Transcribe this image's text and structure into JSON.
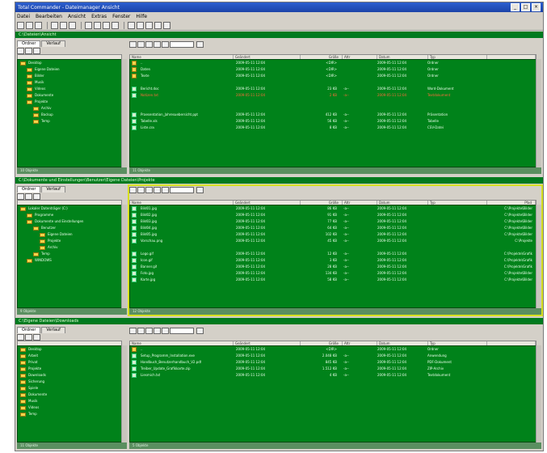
{
  "window": {
    "title": "Total Commander - Dateimanager Ansicht"
  },
  "menu": [
    "Datei",
    "Bearbeiten",
    "Ansicht",
    "Extras",
    "Fenster",
    "Hilfe"
  ],
  "toolbar_icons": [
    "new-icon",
    "open-icon",
    "save-icon",
    "back-icon",
    "forward-icon",
    "up-icon",
    "copy-icon",
    "move-icon",
    "delete-icon",
    "refresh-icon",
    "view-icon",
    "sort-icon",
    "filter-icon",
    "settings-icon",
    "help-icon"
  ],
  "panes": [
    {
      "header": "C:\\Dateien\\Ansicht",
      "left": {
        "tabs": [
          "Ordner",
          "Verlauf"
        ],
        "tree": [
          {
            "label": "Desktop",
            "indent": 0
          },
          {
            "label": "Eigene Dateien",
            "indent": 1
          },
          {
            "label": "Bilder",
            "indent": 1
          },
          {
            "label": "Musik",
            "indent": 1
          },
          {
            "label": "Videos",
            "indent": 1
          },
          {
            "label": "Dokumente",
            "indent": 1
          },
          {
            "label": "Projekte",
            "indent": 1
          },
          {
            "label": "Archiv",
            "indent": 2
          },
          {
            "label": "Backup",
            "indent": 2
          },
          {
            "label": "Temp",
            "indent": 2
          }
        ],
        "status": "10 Objekte"
      },
      "right": {
        "columns": [
          "Name",
          "Geändert",
          "Größe",
          "Attr",
          "Datum",
          "Typ",
          ""
        ],
        "rows": [
          {
            "type": "folder",
            "name": "..",
            "modified": "2009-05-11 12:04",
            "size": "<DIR>",
            "attr": "",
            "date": "2009-05-11 12:04",
            "kind": "Ordner",
            "extra": ""
          },
          {
            "type": "folder",
            "name": "Daten",
            "modified": "2009-05-11 12:04",
            "size": "<DIR>",
            "attr": "",
            "date": "2009-05-11 12:04",
            "kind": "Ordner",
            "extra": ""
          },
          {
            "type": "folder",
            "name": "Texte",
            "modified": "2009-05-11 12:04",
            "size": "<DIR>",
            "attr": "",
            "date": "2009-05-11 12:04",
            "kind": "Ordner",
            "extra": ""
          },
          {
            "type": "file",
            "name": "",
            "modified": "",
            "size": "",
            "attr": "",
            "date": "",
            "kind": "",
            "extra": ""
          },
          {
            "type": "file",
            "name": "Bericht.doc",
            "modified": "2009-05-11 12:04",
            "size": "23 KB",
            "attr": "-a--",
            "date": "2009-05-11 12:04",
            "kind": "Word-Dokument",
            "extra": ""
          },
          {
            "type": "file",
            "name": "Notizen.txt",
            "modified": "2009-05-11 12:04",
            "size": "2 KB",
            "attr": "-a--",
            "date": "2009-05-11 12:04",
            "kind": "Textdokument",
            "extra": "",
            "selected": true
          },
          {
            "type": "file",
            "name": "",
            "modified": "",
            "size": "",
            "attr": "",
            "date": "",
            "kind": "",
            "extra": ""
          },
          {
            "type": "file",
            "name": "",
            "modified": "",
            "size": "",
            "attr": "",
            "date": "",
            "kind": "",
            "extra": ""
          },
          {
            "type": "file",
            "name": "Praesentation_Jahresuebersicht.ppt",
            "modified": "2009-05-11 12:04",
            "size": "412 KB",
            "attr": "-a--",
            "date": "2009-05-11 12:04",
            "kind": "Präsentation",
            "extra": ""
          },
          {
            "type": "file",
            "name": "Tabelle.xls",
            "modified": "2009-05-11 12:04",
            "size": "56 KB",
            "attr": "-a--",
            "date": "2009-05-11 12:04",
            "kind": "Tabelle",
            "extra": ""
          },
          {
            "type": "file",
            "name": "Liste.csv",
            "modified": "2009-05-11 12:04",
            "size": "8 KB",
            "attr": "-a--",
            "date": "2009-05-11 12:04",
            "kind": "CSV-Datei",
            "extra": ""
          }
        ],
        "status": "11 Objekte"
      }
    },
    {
      "header": "C:\\Dokumente und Einstellungen\\Benutzer\\Eigene Dateien\\Projekte",
      "left": {
        "tabs": [
          "Ordner",
          "Verlauf"
        ],
        "tree": [
          {
            "label": "Lokaler Datenträger (C:)",
            "indent": 0
          },
          {
            "label": "Programme",
            "indent": 1
          },
          {
            "label": "Dokumente und Einstellungen",
            "indent": 1
          },
          {
            "label": "Benutzer",
            "indent": 2
          },
          {
            "label": "Eigene Dateien",
            "indent": 3
          },
          {
            "label": "Projekte",
            "indent": 3
          },
          {
            "label": "Archiv",
            "indent": 3
          },
          {
            "label": "Temp",
            "indent": 2
          },
          {
            "label": "WINDOWS",
            "indent": 1
          }
        ],
        "status": "9 Objekte"
      },
      "right": {
        "columns": [
          "Name",
          "Geändert",
          "Größe",
          "Attr",
          "Datum",
          "Typ",
          "Pfad"
        ],
        "rows": [
          {
            "type": "file",
            "name": "Bild01.jpg",
            "modified": "2009-05-11 12:04",
            "size": "86 KB",
            "attr": "-a--",
            "date": "2009-05-11 12:04",
            "kind": "",
            "extra": "C:\\Projekte\\Bilder"
          },
          {
            "type": "file",
            "name": "Bild02.jpg",
            "modified": "2009-05-11 12:04",
            "size": "91 KB",
            "attr": "-a--",
            "date": "2009-05-11 12:04",
            "kind": "",
            "extra": "C:\\Projekte\\Bilder"
          },
          {
            "type": "file",
            "name": "Bild03.jpg",
            "modified": "2009-05-11 12:04",
            "size": "77 KB",
            "attr": "-a--",
            "date": "2009-05-11 12:04",
            "kind": "",
            "extra": "C:\\Projekte\\Bilder"
          },
          {
            "type": "file",
            "name": "Bild04.jpg",
            "modified": "2009-05-11 12:04",
            "size": "64 KB",
            "attr": "-a--",
            "date": "2009-05-11 12:04",
            "kind": "",
            "extra": "C:\\Projekte\\Bilder"
          },
          {
            "type": "file",
            "name": "Bild05.jpg",
            "modified": "2009-05-11 12:04",
            "size": "102 KB",
            "attr": "-a--",
            "date": "2009-05-11 12:04",
            "kind": "",
            "extra": "C:\\Projekte\\Bilder"
          },
          {
            "type": "file",
            "name": "Vorschau.png",
            "modified": "2009-05-11 12:04",
            "size": "45 KB",
            "attr": "-a--",
            "date": "2009-05-11 12:04",
            "kind": "",
            "extra": "C:\\Projekte"
          },
          {
            "type": "file",
            "name": "",
            "modified": "",
            "size": "",
            "attr": "",
            "date": "",
            "kind": "",
            "extra": ""
          },
          {
            "type": "file",
            "name": "Logo.gif",
            "modified": "2009-05-11 12:04",
            "size": "12 KB",
            "attr": "-a--",
            "date": "2009-05-11 12:04",
            "kind": "",
            "extra": "C:\\Projekte\\Grafik"
          },
          {
            "type": "file",
            "name": "Icon.gif",
            "modified": "2009-05-11 12:04",
            "size": "3 KB",
            "attr": "-a--",
            "date": "2009-05-11 12:04",
            "kind": "",
            "extra": "C:\\Projekte\\Grafik"
          },
          {
            "type": "file",
            "name": "Banner.gif",
            "modified": "2009-05-11 12:04",
            "size": "28 KB",
            "attr": "-a--",
            "date": "2009-05-11 12:04",
            "kind": "",
            "extra": "C:\\Projekte\\Grafik"
          },
          {
            "type": "file",
            "name": "Foto.jpg",
            "modified": "2009-05-11 12:04",
            "size": "134 KB",
            "attr": "-a--",
            "date": "2009-05-11 12:04",
            "kind": "",
            "extra": "C:\\Projekte\\Bilder"
          },
          {
            "type": "file",
            "name": "Karte.jpg",
            "modified": "2009-05-11 12:04",
            "size": "58 KB",
            "attr": "-a--",
            "date": "2009-05-11 12:04",
            "kind": "",
            "extra": "C:\\Projekte\\Bilder"
          }
        ],
        "status": "12 Objekte"
      }
    },
    {
      "header": "C:\\Eigene Dateien\\Downloads",
      "left": {
        "tabs": [
          "Ordner",
          "Verlauf"
        ],
        "tree": [
          {
            "label": "Desktop",
            "indent": 0
          },
          {
            "label": "Arbeit",
            "indent": 0
          },
          {
            "label": "Privat",
            "indent": 0
          },
          {
            "label": "Projekte",
            "indent": 0
          },
          {
            "label": "Downloads",
            "indent": 0
          },
          {
            "label": "Sicherung",
            "indent": 0
          },
          {
            "label": "Spiele",
            "indent": 0
          },
          {
            "label": "Dokumente",
            "indent": 0
          },
          {
            "label": "Musik",
            "indent": 0
          },
          {
            "label": "Videos",
            "indent": 0
          },
          {
            "label": "Temp",
            "indent": 0
          }
        ],
        "status": "11 Objekte"
      },
      "right": {
        "columns": [
          "Name",
          "Geändert",
          "Größe",
          "Attr",
          "Datum",
          "Typ",
          ""
        ],
        "rows": [
          {
            "type": "folder",
            "name": "..",
            "modified": "2009-05-11 12:04",
            "size": "<DIR>",
            "attr": "",
            "date": "2009-05-11 12:04",
            "kind": "Ordner",
            "extra": ""
          },
          {
            "type": "file",
            "name": "Setup_Programm_Installation.exe",
            "modified": "2009-05-11 12:04",
            "size": "2.048 KB",
            "attr": "-a--",
            "date": "2009-05-11 12:04",
            "kind": "Anwendung",
            "extra": ""
          },
          {
            "type": "file",
            "name": "Handbuch_Benutzerhandbuch_V2.pdf",
            "modified": "2009-05-11 12:04",
            "size": "845 KB",
            "attr": "-a--",
            "date": "2009-05-11 12:04",
            "kind": "PDF-Dokument",
            "extra": ""
          },
          {
            "type": "file",
            "name": "Treiber_Update_Grafikkarte.zip",
            "modified": "2009-05-11 12:04",
            "size": "1.512 KB",
            "attr": "-a--",
            "date": "2009-05-11 12:04",
            "kind": "ZIP-Archiv",
            "extra": ""
          },
          {
            "type": "file",
            "name": "Liesmich.txt",
            "modified": "2009-05-11 12:04",
            "size": "4 KB",
            "attr": "-a--",
            "date": "2009-05-11 12:04",
            "kind": "Textdokument",
            "extra": ""
          }
        ],
        "status": "5 Objekte"
      }
    }
  ]
}
